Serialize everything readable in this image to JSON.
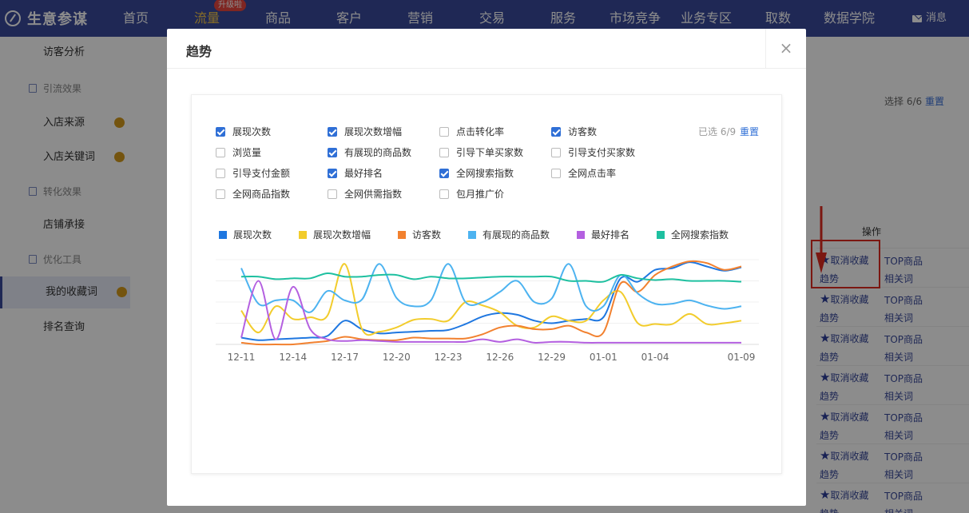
{
  "app": {
    "brand": "生意参谋",
    "nav": [
      {
        "label": "首页",
        "x": 154
      },
      {
        "label": "流量",
        "x": 243,
        "active": true,
        "badge": "升级啦"
      },
      {
        "label": "商品",
        "x": 332
      },
      {
        "label": "客户",
        "x": 421
      },
      {
        "label": "营销",
        "x": 510
      },
      {
        "label": "交易",
        "x": 600
      },
      {
        "label": "服务",
        "x": 689
      },
      {
        "label": "市场竞争",
        "x": 763
      },
      {
        "label": "业务专区",
        "x": 852
      },
      {
        "label": "取数",
        "x": 958
      },
      {
        "label": "数据学院",
        "x": 1031
      }
    ],
    "message": "消息"
  },
  "sidebar": {
    "items": [
      {
        "label": "访客分析",
        "type": "sub",
        "top": 0
      },
      {
        "label": "引流效果",
        "type": "group",
        "top": 44
      },
      {
        "label": "入店来源",
        "type": "sub",
        "top": 88,
        "dot": true
      },
      {
        "label": "入店关键词",
        "type": "sub",
        "top": 131,
        "dot": true
      },
      {
        "label": "转化效果",
        "type": "group",
        "top": 173
      },
      {
        "label": "店铺承接",
        "type": "sub",
        "top": 216
      },
      {
        "label": "优化工具",
        "type": "group",
        "top": 258
      },
      {
        "label": "我的收藏词",
        "type": "sub",
        "top": 300,
        "dot": true,
        "selected": true
      },
      {
        "label": "排名查询",
        "type": "sub",
        "top": 344
      }
    ]
  },
  "background": {
    "select_count": "选择 6/6",
    "reset": "重置",
    "ops_header": "操作",
    "row_actions": {
      "fav": "取消收藏",
      "trend": "趋势",
      "top": "TOP商品",
      "related": "相关词"
    }
  },
  "modal": {
    "title": "趋势",
    "close": "×",
    "selected_count": "已选 6/9",
    "reset": "重置",
    "metrics": [
      {
        "label": "展现次数",
        "checked": true
      },
      {
        "label": "展现次数增幅",
        "checked": true
      },
      {
        "label": "点击转化率",
        "checked": false
      },
      {
        "label": "访客数",
        "checked": true
      },
      {
        "label": "浏览量",
        "checked": false
      },
      {
        "label": "有展现的商品数",
        "checked": true
      },
      {
        "label": "引导下单买家数",
        "checked": false
      },
      {
        "label": "引导支付买家数",
        "checked": false
      },
      {
        "label": "引导支付金额",
        "checked": false
      },
      {
        "label": "最好排名",
        "checked": true
      },
      {
        "label": "全网搜索指数",
        "checked": true
      },
      {
        "label": "全网点击率",
        "checked": false
      },
      {
        "label": "全网商品指数",
        "checked": false
      },
      {
        "label": "全网供需指数",
        "checked": false
      },
      {
        "label": "包月推广价",
        "checked": false
      }
    ]
  },
  "chart_data": {
    "type": "line",
    "x": [
      "12-11",
      "12-12",
      "12-13",
      "12-14",
      "12-15",
      "12-16",
      "12-17",
      "12-18",
      "12-19",
      "12-20",
      "12-21",
      "12-22",
      "12-23",
      "12-24",
      "12-25",
      "12-26",
      "12-27",
      "12-28",
      "12-29",
      "12-30",
      "12-31",
      "01-01",
      "01-02",
      "01-03",
      "01-04",
      "01-05",
      "01-06",
      "01-07",
      "01-08",
      "01-09"
    ],
    "x_tick_labels": [
      "12-11",
      "12-14",
      "12-17",
      "12-20",
      "12-23",
      "12-26",
      "12-29",
      "01-01",
      "01-04",
      "01-09"
    ],
    "ylim": [
      0,
      100
    ],
    "grid": true,
    "legend_position": "top",
    "series": [
      {
        "name": "展现次数",
        "color": "#1f77e0",
        "values": [
          8,
          5,
          6,
          7,
          8,
          10,
          28,
          18,
          13,
          14,
          15,
          16,
          17,
          24,
          33,
          37,
          35,
          28,
          25,
          28,
          30,
          32,
          78,
          74,
          88,
          90,
          97,
          92,
          87,
          91
        ]
      },
      {
        "name": "展现次数增幅",
        "color": "#f2cc2c",
        "values": [
          40,
          14,
          45,
          30,
          32,
          34,
          95,
          18,
          15,
          20,
          29,
          30,
          28,
          50,
          46,
          38,
          22,
          20,
          33,
          28,
          28,
          52,
          62,
          25,
          24,
          24,
          36,
          24,
          25,
          28
        ]
      },
      {
        "name": "访客数",
        "color": "#f2812f",
        "values": [
          2,
          0,
          0,
          0,
          2,
          4,
          9,
          6,
          5,
          5,
          8,
          7,
          7,
          7,
          12,
          20,
          22,
          18,
          18,
          22,
          14,
          14,
          72,
          62,
          82,
          92,
          98,
          96,
          88,
          92
        ]
      },
      {
        "name": "有展现的商品数",
        "color": "#4db3f0",
        "values": [
          90,
          48,
          52,
          52,
          38,
          63,
          52,
          53,
          95,
          55,
          45,
          52,
          95,
          50,
          50,
          62,
          75,
          50,
          54,
          95,
          45,
          45,
          82,
          60,
          48,
          48,
          52,
          46,
          42,
          45
        ]
      },
      {
        "name": "最好排名",
        "color": "#b460e0",
        "values": [
          8,
          75,
          6,
          68,
          18,
          6,
          4,
          5,
          4,
          3,
          3,
          3,
          3,
          3,
          6,
          3,
          6,
          2,
          3,
          3,
          2,
          2,
          2,
          2,
          2,
          2,
          2,
          2,
          2,
          2
        ]
      },
      {
        "name": "全网搜索指数",
        "color": "#1ec0a0",
        "values": [
          80,
          80,
          77,
          78,
          78,
          84,
          80,
          80,
          82,
          82,
          77,
          80,
          78,
          78,
          79,
          80,
          80,
          80,
          80,
          75,
          75,
          74,
          82,
          78,
          76,
          77,
          75,
          75,
          75,
          74
        ]
      }
    ]
  }
}
